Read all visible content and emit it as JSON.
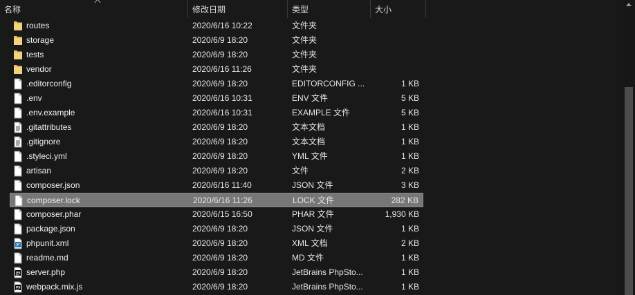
{
  "columns": {
    "name": "名称",
    "date": "修改日期",
    "type": "类型",
    "size": "大小"
  },
  "colors": {
    "background": "#191919",
    "selected": "#777777",
    "folder": "#e8c26a"
  },
  "files": [
    {
      "name": "routes",
      "date": "2020/6/16 10:22",
      "type": "文件夹",
      "size": "",
      "icon": "folder-icon"
    },
    {
      "name": "storage",
      "date": "2020/6/9 18:20",
      "type": "文件夹",
      "size": "",
      "icon": "folder-icon"
    },
    {
      "name": "tests",
      "date": "2020/6/9 18:20",
      "type": "文件夹",
      "size": "",
      "icon": "folder-icon"
    },
    {
      "name": "vendor",
      "date": "2020/6/16 11:26",
      "type": "文件夹",
      "size": "",
      "icon": "folder-icon"
    },
    {
      "name": ".editorconfig",
      "date": "2020/6/9 18:20",
      "type": "EDITORCONFIG ...",
      "size": "1 KB",
      "icon": "file-icon"
    },
    {
      "name": ".env",
      "date": "2020/6/16 10:31",
      "type": "ENV 文件",
      "size": "5 KB",
      "icon": "file-icon"
    },
    {
      "name": ".env.example",
      "date": "2020/6/16 10:31",
      "type": "EXAMPLE 文件",
      "size": "5 KB",
      "icon": "file-icon"
    },
    {
      "name": ".gitattributes",
      "date": "2020/6/9 18:20",
      "type": "文本文档",
      "size": "1 KB",
      "icon": "text-file-icon"
    },
    {
      "name": ".gitignore",
      "date": "2020/6/9 18:20",
      "type": "文本文档",
      "size": "1 KB",
      "icon": "text-file-icon"
    },
    {
      "name": ".styleci.yml",
      "date": "2020/6/9 18:20",
      "type": "YML 文件",
      "size": "1 KB",
      "icon": "file-icon"
    },
    {
      "name": "artisan",
      "date": "2020/6/9 18:20",
      "type": "文件",
      "size": "2 KB",
      "icon": "file-icon"
    },
    {
      "name": "composer.json",
      "date": "2020/6/16 11:40",
      "type": "JSON 文件",
      "size": "3 KB",
      "icon": "file-icon"
    },
    {
      "name": "composer.lock",
      "date": "2020/6/16 11:26",
      "type": "LOCK 文件",
      "size": "282 KB",
      "icon": "file-icon",
      "selected": true
    },
    {
      "name": "composer.phar",
      "date": "2020/6/15 16:50",
      "type": "PHAR 文件",
      "size": "1,930 KB",
      "icon": "file-icon"
    },
    {
      "name": "package.json",
      "date": "2020/6/9 18:20",
      "type": "JSON 文件",
      "size": "1 KB",
      "icon": "file-icon"
    },
    {
      "name": "phpunit.xml",
      "date": "2020/6/9 18:20",
      "type": "XML 文档",
      "size": "2 KB",
      "icon": "xml-file-icon"
    },
    {
      "name": "readme.md",
      "date": "2020/6/9 18:20",
      "type": "MD 文件",
      "size": "1 KB",
      "icon": "file-icon"
    },
    {
      "name": "server.php",
      "date": "2020/6/9 18:20",
      "type": "JetBrains PhpSto...",
      "size": "1 KB",
      "icon": "phpstorm-file-icon"
    },
    {
      "name": "webpack.mix.js",
      "date": "2020/6/9 18:20",
      "type": "JetBrains PhpSto...",
      "size": "1 KB",
      "icon": "phpstorm-file-icon"
    }
  ]
}
